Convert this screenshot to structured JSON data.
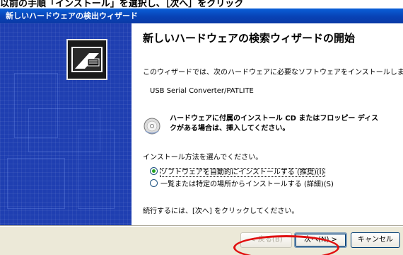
{
  "top_banner": "以前の手順「インストール」を選択し、［次へ］をクリック",
  "window": {
    "title": "新しいハードウェアの検出ウィザード"
  },
  "content": {
    "heading": "新しいハードウェアの検索ウィザードの開始",
    "intro": "このウィザードでは、次のハードウェアに必要なソフトウェアをインストールします:",
    "device": "USB Serial Converter/PATLITE",
    "cd_text": "ハードウェアに付属のインストール CD またはフロッピー ディスクがある場合は、挿入してください。",
    "choose": "インストール方法を選んでください。",
    "options": [
      {
        "label": "ソフトウェアを自動的にインストールする (推奨)(I)",
        "selected": true
      },
      {
        "label": "一覧または特定の場所からインストールする (詳細)(S)",
        "selected": false
      }
    ],
    "continue": "続行するには、[次へ] をクリックしてください。"
  },
  "buttons": {
    "back": "< 戻る(B)",
    "next": "次へ(N) >",
    "cancel": "キャンセル"
  },
  "colors": {
    "title_bar": "#0a4fc8",
    "side_panel": "#1f3fb1",
    "annotation": "#e01010"
  }
}
